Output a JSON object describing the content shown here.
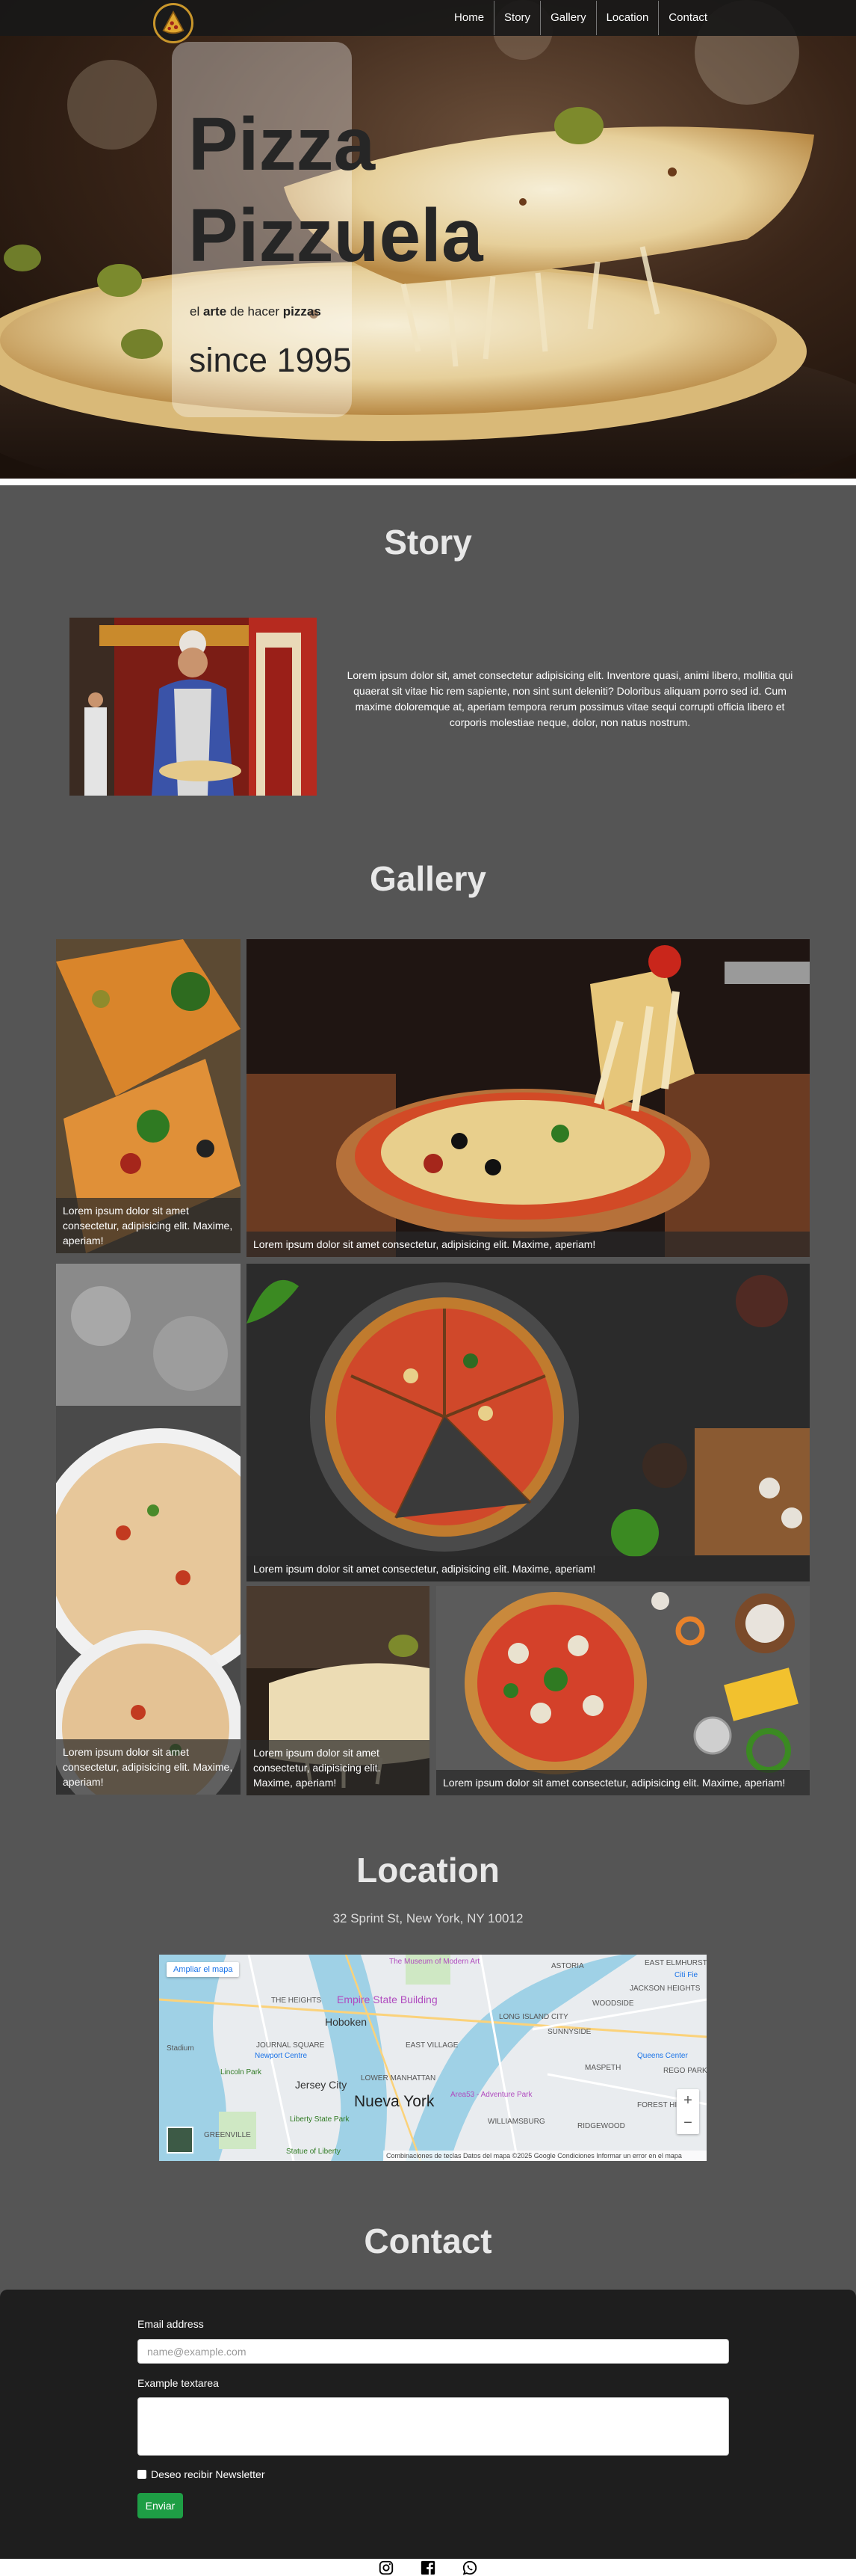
{
  "nav": {
    "items": [
      "Home",
      "Story",
      "Gallery",
      "Location",
      "Contact"
    ]
  },
  "hero": {
    "title_line_1": "Pizza",
    "title_line_2": "Pizzuela",
    "tagline": {
      "el": "el",
      "arte": "arte",
      "de_hacer": "de hacer",
      "pizzas": "pizzas"
    },
    "since": "since 1995"
  },
  "story": {
    "title": "Story",
    "text": "Lorem ipsum dolor sit, amet consectetur adipisicing elit. Inventore quasi, animi libero, mollitia qui quaerat sit vitae hic rem sapiente, non sint sunt deleniti? Doloribus aliquam porro sed id. Cum maxime doloremque at, aperiam tempora rerum possimus vitae sequi corrupti officia libero et corporis molestiae neque, dolor, non natus nostrum."
  },
  "gallery": {
    "title": "Gallery",
    "items": [
      {
        "caption": "Lorem ipsum dolor sit amet consectetur, adipisicing elit. Maxime, aperiam!"
      },
      {
        "caption": "Lorem ipsum dolor sit amet consectetur, adipisicing elit. Maxime, aperiam!"
      },
      {
        "caption": "Lorem ipsum dolor sit amet consectetur, adipisicing elit. Maxime, aperiam!"
      },
      {
        "caption": "Lorem ipsum dolor sit amet consectetur, adipisicing elit. Maxime, aperiam!"
      },
      {
        "caption": "Lorem ipsum dolor sit amet consectetur, adipisicing elit. Maxime, aperiam!"
      },
      {
        "caption": "Lorem ipsum dolor sit amet consectetur, adipisicing elit. Maxime, aperiam!"
      }
    ]
  },
  "location": {
    "title": "Location",
    "address": "32 Sprint St, New York, NY 10012",
    "map": {
      "expand_label": "Ampliar el mapa",
      "labels": {
        "museum": "The Museum of Modern Art",
        "empire": "Empire State Building",
        "hoboken": "Hoboken",
        "jersey_city": "Jersey City",
        "nueva_york": "Nueva York",
        "liberty": "Liberty State Park",
        "newport": "Newport Centre",
        "lincoln": "Lincoln Park",
        "queens": "Queens Center",
        "williamsburg": "WILLIAMSBURG",
        "astoria": "ASTORIA",
        "elmhurst": "EAST ELMHURST",
        "heights": "JACKSON HEIGHTS",
        "ridgewood": "RIDGEWOOD",
        "maspeth": "MASPETH",
        "citi": "Citi Fie",
        "long_island": "LONG ISLAND CITY",
        "journal": "JOURNAL SQUARE",
        "east_village": "EAST VILLAGE",
        "manhattan": "LOWER MANHATTAN",
        "greenville": "GREENVILLE",
        "stadium": "Stadium",
        "statue": "Statue of Liberty",
        "area53": "Area53 - Adventure Park",
        "forest": "FOREST HILLS",
        "rego": "REGO PARK",
        "sunnyside": "SUNNYSIDE",
        "heights2": "THE HEIGHTS",
        "woodside": "WOODSIDE"
      },
      "footer": "Combinaciones de teclas    Datos del mapa ©2025 Google    Condiciones    Informar un error en el mapa",
      "zoom_in": "+",
      "zoom_out": "−"
    }
  },
  "contact": {
    "title": "Contact",
    "email_label": "Email address",
    "email_placeholder": "name@example.com",
    "textarea_label": "Example textarea",
    "newsletter_label": "Deseo recibir Newsletter",
    "submit_label": "Enviar"
  },
  "footer": {
    "icons": [
      "instagram-icon",
      "facebook-icon",
      "whatsapp-icon"
    ]
  }
}
